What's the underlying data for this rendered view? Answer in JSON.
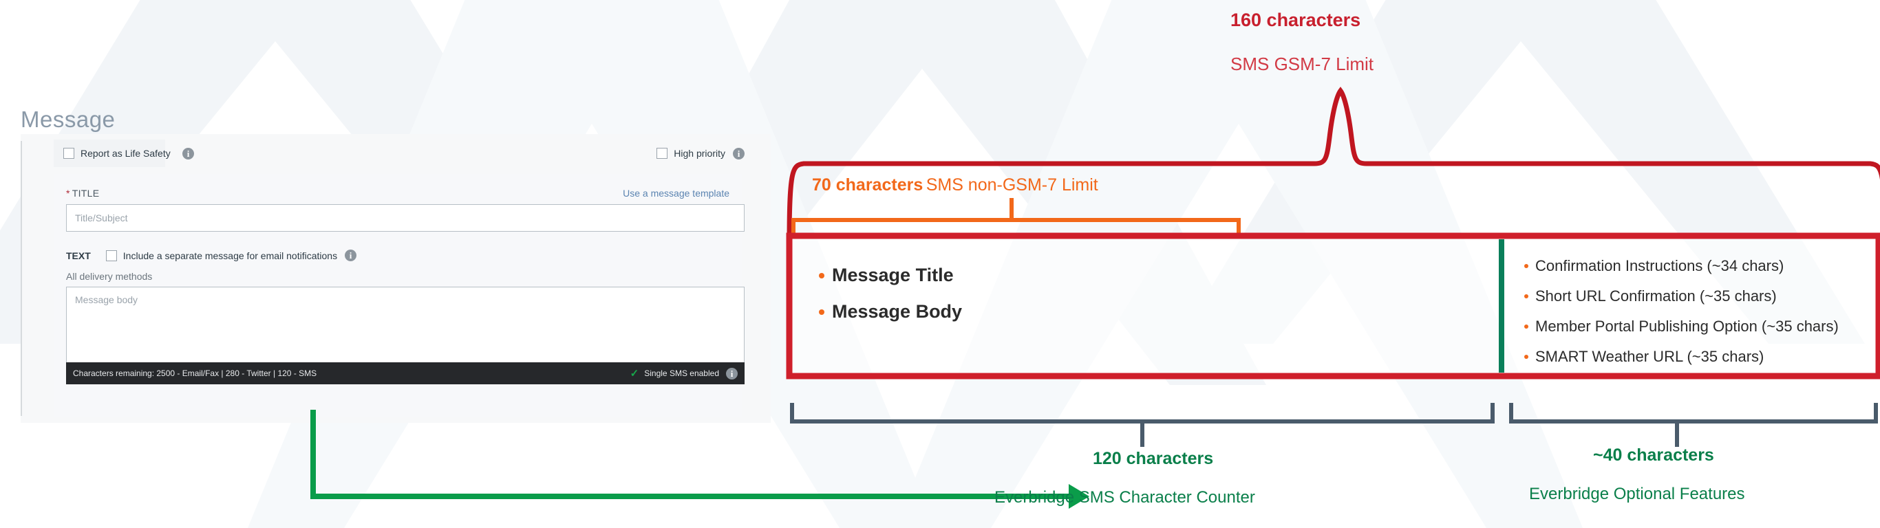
{
  "form": {
    "page_title": "Message",
    "life_safety_label": "Report as Life Safety",
    "high_priority_label": "High priority",
    "title_field_label": "TITLE",
    "title_required_mark": "*",
    "use_template_link": "Use a message template",
    "title_placeholder": "Title/Subject",
    "text_keyword": "TEXT",
    "separate_email_label": "Include a separate message for email notifications",
    "delivery_methods_label": "All delivery methods",
    "body_placeholder": "Message body",
    "status_left": "Characters remaining:  2500 - Email/Fax  |  280 - Twitter  |  120 - SMS",
    "status_right": "Single SMS enabled",
    "check_glyph": "✓",
    "info_glyph": "i"
  },
  "annotations": {
    "gsm7": {
      "count": "160 characters",
      "label": "SMS GSM-7 Limit",
      "color": "#c8202e"
    },
    "non_gsm7": {
      "count": "70 characters",
      "label": "SMS non-GSM-7 Limit",
      "color": "#f2681a"
    },
    "counter": {
      "count": "120 characters",
      "label": "Everbridge SMS Character Counter",
      "color": "#0a7f4a"
    },
    "optional": {
      "count": "~40 characters",
      "label": "Everbridge Optional Features",
      "color": "#0a7f4a"
    }
  },
  "red_box": {
    "border_color": "#cf1f2b",
    "divider_color": "#0a7f5a",
    "primary_items": [
      {
        "label": "Message Title"
      },
      {
        "label": "Message Body"
      }
    ],
    "optional_items": [
      {
        "label": "Confirmation Instructions (~34 chars)"
      },
      {
        "label": "Short URL Confirmation (~35 chars)"
      },
      {
        "label": "Member Portal Publishing Option (~35 chars)"
      },
      {
        "label": "SMART Weather URL (~35 chars)"
      }
    ]
  },
  "palette": {
    "red": "#c8202e",
    "orange": "#f2681a",
    "green": "#0a9c4a",
    "dark_green": "#0a7f4a",
    "navy": "#4a5b6b",
    "status_bar": "#26282b"
  }
}
